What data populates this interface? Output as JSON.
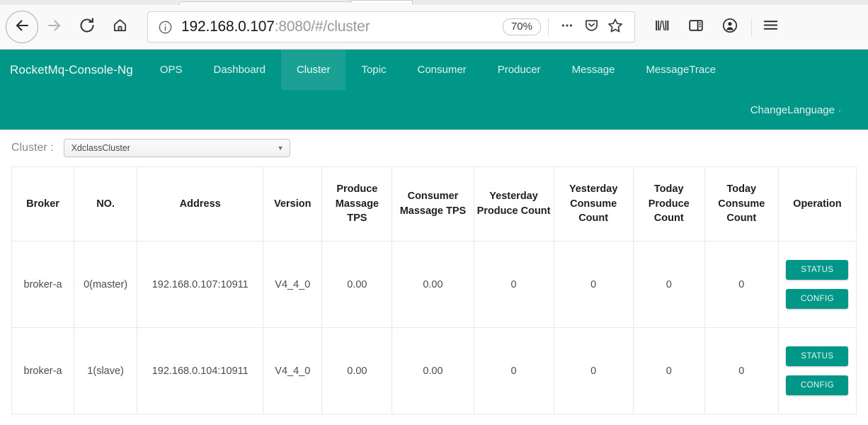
{
  "browser": {
    "back_icon": "back-arrow-icon",
    "forward_icon": "forward-arrow-icon",
    "reload_icon": "reload-icon",
    "home_icon": "home-icon",
    "identity_icon": "info-circle-icon",
    "url_host": "192.168.0.107",
    "url_rest": ":8080/#/cluster",
    "url_full": "192.168.0.107:8080/#/cluster",
    "zoom_level": "70%",
    "page_actions_icon": "ellipsis-icon",
    "pocket_icon": "pocket-shield-icon",
    "bookmark_icon": "star-icon",
    "library_icon": "library-icon",
    "sidebar_icon": "sidebar-icon",
    "account_icon": "account-avatar-icon",
    "menu_icon": "hamburger-menu-icon"
  },
  "app": {
    "brand": "RocketMq-Console-Ng",
    "nav_items": [
      {
        "label": "OPS",
        "active": false
      },
      {
        "label": "Dashboard",
        "active": false
      },
      {
        "label": "Cluster",
        "active": true
      },
      {
        "label": "Topic",
        "active": false
      },
      {
        "label": "Consumer",
        "active": false
      },
      {
        "label": "Producer",
        "active": false
      },
      {
        "label": "Message",
        "active": false
      },
      {
        "label": "MessageTrace",
        "active": false
      }
    ],
    "change_language": "ChangeLanguage",
    "change_language_caret": "·",
    "theme_color": "#009688",
    "active_tab_color": "#1aa193"
  },
  "cluster_selector": {
    "label": "Cluster :",
    "selected": "XdclassCluster",
    "caret": "▼"
  },
  "table": {
    "headers": [
      "Broker",
      "NO.",
      "Address",
      "Version",
      "Produce Massage TPS",
      "Consumer Massage TPS",
      "Yesterday Produce Count",
      "Yesterday Consume Count",
      "Today Produce Count",
      "Today Consume Count",
      "Operation"
    ],
    "rows": [
      {
        "broker": "broker-a",
        "no": "0(master)",
        "address": "192.168.0.107:10911",
        "version": "V4_4_0",
        "produce_tps": "0.00",
        "consume_tps": "0.00",
        "yesterday_produce": "0",
        "yesterday_consume": "0",
        "today_produce": "0",
        "today_consume": "0",
        "status_label": "STATUS",
        "config_label": "CONFIG"
      },
      {
        "broker": "broker-a",
        "no": "1(slave)",
        "address": "192.168.0.104:10911",
        "version": "V4_4_0",
        "produce_tps": "0.00",
        "consume_tps": "0.00",
        "yesterday_produce": "0",
        "yesterday_consume": "0",
        "today_produce": "0",
        "today_consume": "0",
        "status_label": "STATUS",
        "config_label": "CONFIG"
      }
    ]
  }
}
